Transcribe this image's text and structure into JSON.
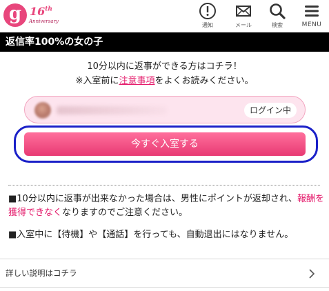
{
  "header": {
    "logo": {
      "letter": "g",
      "num": "16",
      "sup": "th",
      "sub": "Anniversary"
    },
    "icons": [
      {
        "name": "notice-icon",
        "label": "通知"
      },
      {
        "name": "mail-icon",
        "label": "メール"
      },
      {
        "name": "search-icon",
        "label": "検索"
      },
      {
        "name": "menu-icon",
        "label": "MENU"
      }
    ]
  },
  "section": {
    "title": "返信率100%の女の子"
  },
  "intro": {
    "line1": "10分以内に返事ができる方はコチラ！",
    "line2_prefix": "※入室前に",
    "line2_link": "注意事項",
    "line2_suffix": "をよくお読みください。"
  },
  "user": {
    "status": "ログイン中"
  },
  "enter_button": {
    "label": "今すぐ入室する"
  },
  "notes": {
    "note1_prefix": "■10分以内に返事が出来なかった場合は、男性にポイントが返却され、",
    "note1_red": "報酬を獲得できなく",
    "note1_suffix": "なりますのでご注意ください。",
    "note2": "■入室中に【待機】や【通話】を行っても、自動退出にはなりません。"
  },
  "detail": {
    "label": "詳しい説明はコチラ"
  },
  "colors": {
    "accent": "#e8467c",
    "link": "#e4196a",
    "outline": "#1a20c8",
    "title_bg": "#000000"
  }
}
